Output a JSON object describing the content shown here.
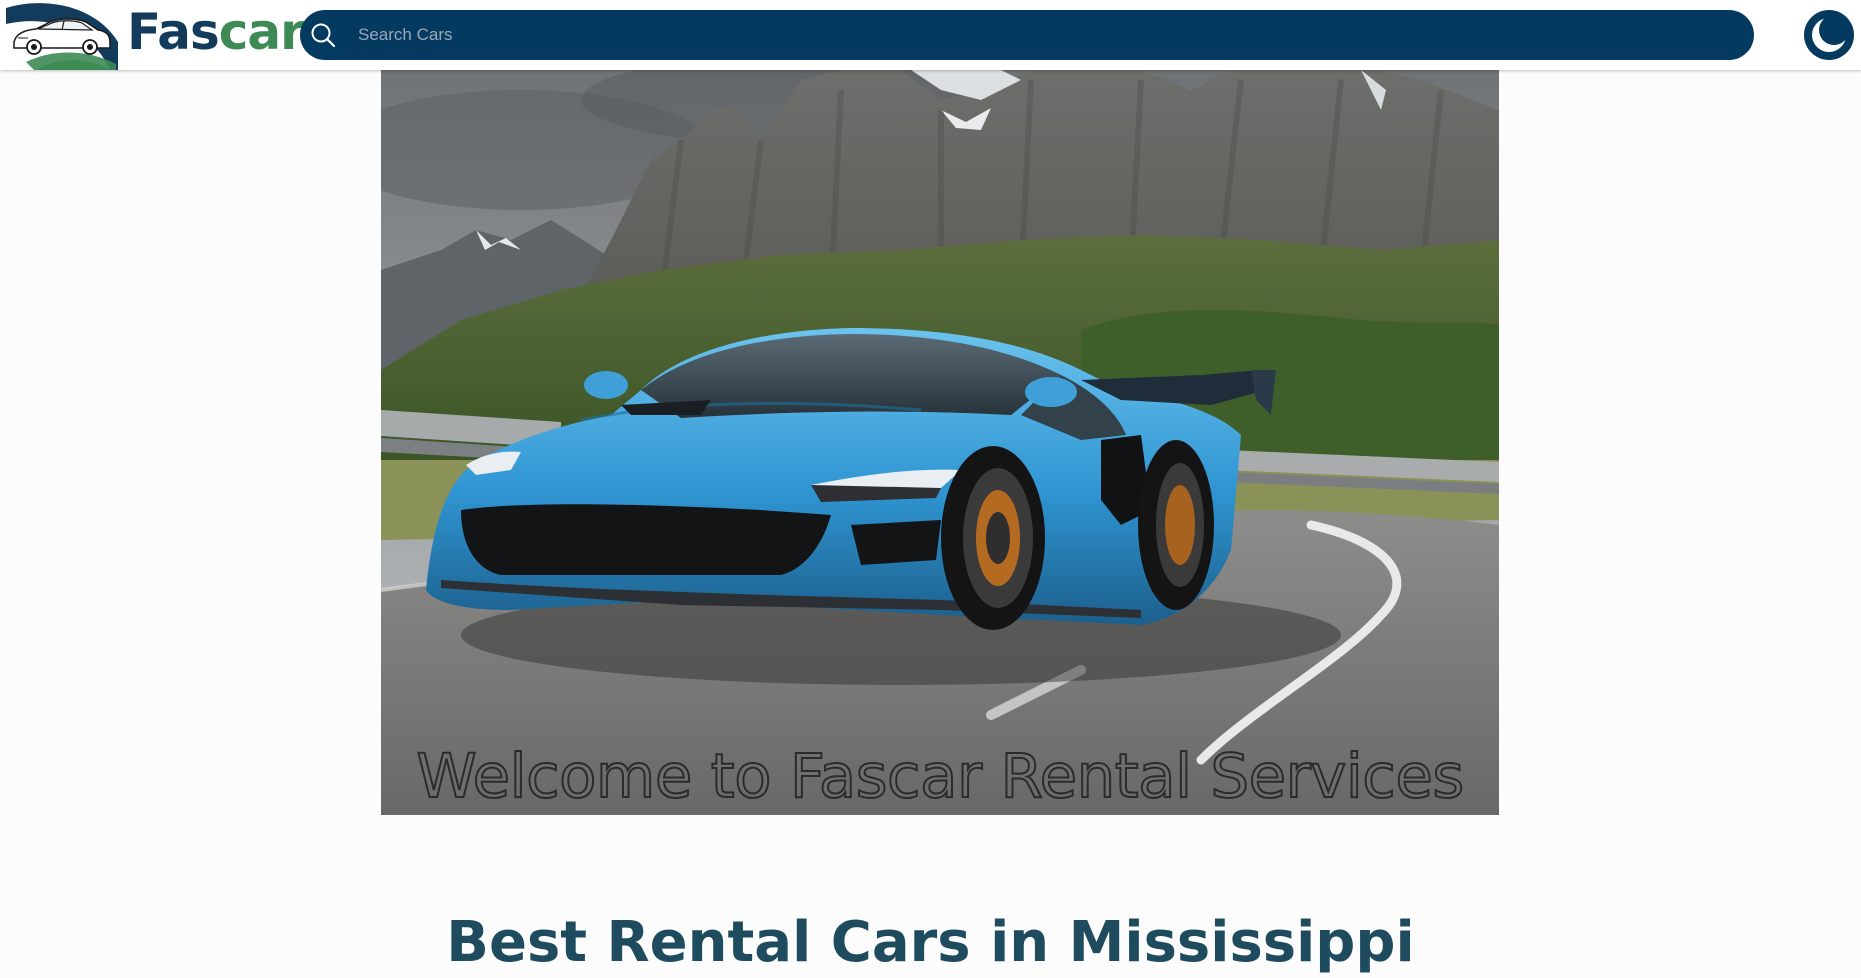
{
  "header": {
    "logo": {
      "name_part1": "Fas",
      "name_part2": "car"
    },
    "search": {
      "placeholder": "Search Cars",
      "value": ""
    },
    "theme_toggle": {
      "icon": "moon-icon"
    }
  },
  "hero": {
    "title": "Welcome to Fascar Rental Services",
    "image": "blue-sports-car-on-mountain-road"
  },
  "section": {
    "heading": "Best Rental Cars in Mississippi"
  },
  "colors": {
    "brand_navy": "#053a60",
    "brand_green": "#3d8a54",
    "logo_navy": "#123b5c",
    "heading": "#1e4b5e",
    "page_bg": "#fcfcfc"
  }
}
